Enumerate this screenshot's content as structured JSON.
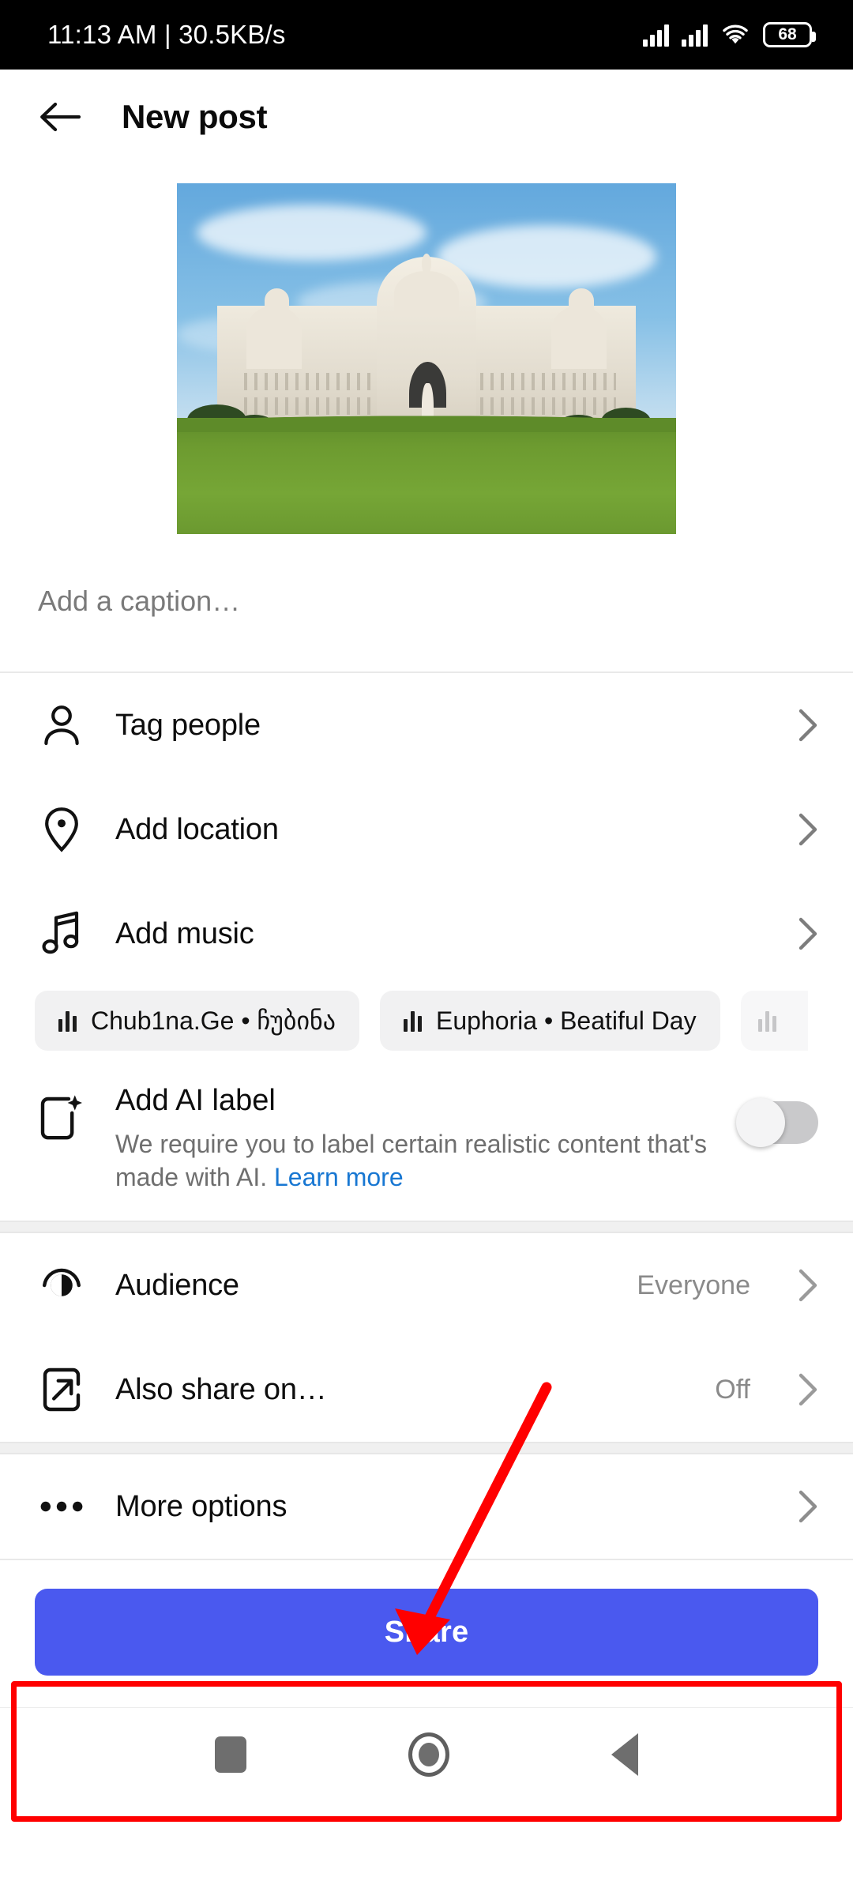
{
  "status_bar": {
    "time": "11:13 AM",
    "separator": "|",
    "network_speed": "30.5KB/s",
    "time_and_speed": "11:13 AM | 30.5KB/s",
    "battery_level": "68",
    "icons": [
      "signal-bars-icon",
      "signal-bars-icon",
      "wifi-icon",
      "battery-icon"
    ]
  },
  "header": {
    "back_icon": "arrow-left-icon",
    "title": "New post"
  },
  "media": {
    "alt": "photo-thumbnail"
  },
  "caption": {
    "placeholder": "Add a caption…"
  },
  "options": {
    "tag_people": {
      "label": "Tag people",
      "icon": "person-icon",
      "chevron": "chevron-right-icon"
    },
    "add_location": {
      "label": "Add location",
      "icon": "location-pin-icon",
      "chevron": "chevron-right-icon"
    },
    "add_music": {
      "label": "Add music",
      "icon": "music-note-icon",
      "chevron": "chevron-right-icon"
    }
  },
  "music_suggestions": [
    {
      "title": "Chub1na.Ge • ჩუბინა",
      "icon": "equalizer-icon"
    },
    {
      "title": "Euphoria • Beatiful Day",
      "icon": "equalizer-icon"
    },
    {
      "title": "",
      "icon": "equalizer-icon"
    }
  ],
  "ai_label": {
    "icon": "ai-sparkle-icon",
    "title": "Add AI label",
    "description": "We require you to label certain realistic content that's made with AI. ",
    "link_text": "Learn more",
    "toggle_state": "off"
  },
  "privacy": {
    "audience": {
      "label": "Audience",
      "value": "Everyone",
      "icon": "audience-eye-icon",
      "chevron": "chevron-right-icon"
    },
    "also_share_on": {
      "label": "Also share on…",
      "value": "Off",
      "icon": "share-arrow-icon",
      "chevron": "chevron-right-icon"
    }
  },
  "more": {
    "label": "More options",
    "icon": "ellipsis-icon",
    "chevron": "chevron-right-icon"
  },
  "share": {
    "label": "Share",
    "color": "#4a59ef"
  },
  "nav_bar": {
    "recents": "square-icon",
    "home": "circle-icon",
    "back": "triangle-back-icon"
  },
  "annotations": {
    "highlight_color": "#ff0000",
    "arrow": "red-arrow-pointing-to-share-button",
    "box": "red-rectangle-around-share-button"
  }
}
